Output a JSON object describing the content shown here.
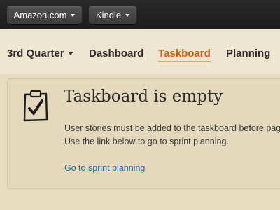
{
  "topbar": {
    "org_label": "Amazon.com",
    "product_label": "Kindle"
  },
  "nav": {
    "quarter_label": "3rd Quarter",
    "items": [
      {
        "label": "Dashboard"
      },
      {
        "label": "Taskboard",
        "active": true
      },
      {
        "label": "Planning"
      }
    ],
    "active_color": "#c95f16"
  },
  "empty_state": {
    "icon": "clipboard-check-icon",
    "title": "Taskboard is empty",
    "message": "User stories must be added to the taskboard before page. Use the link below to go to sprint planning.",
    "link_label": "Go to sprint planning"
  }
}
